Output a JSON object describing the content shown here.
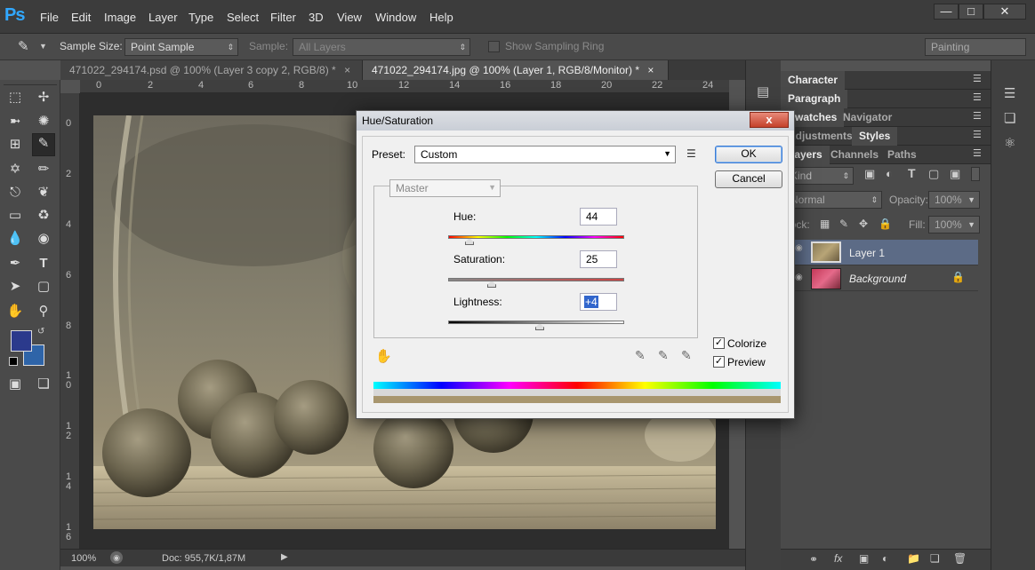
{
  "app": {
    "logo": "Ps"
  },
  "menu": [
    "File",
    "Edit",
    "Image",
    "Layer",
    "Type",
    "Select",
    "Filter",
    "3D",
    "View",
    "Window",
    "Help"
  ],
  "options": {
    "sample_size_label": "Sample Size:",
    "sample_size_value": "Point Sample",
    "sample_label": "Sample:",
    "sample_value": "All Layers",
    "sampling_ring_label": "Show Sampling Ring",
    "workspace": "Painting"
  },
  "tabs": [
    {
      "label": "471022_294174.psd @ 100% (Layer 3 copy 2, RGB/8) *",
      "close": "×"
    },
    {
      "label": "471022_294174.jpg @ 100% (Layer 1, RGB/8/Monitor) *",
      "close": "×"
    }
  ],
  "ruler": {
    "h": [
      "0",
      "2",
      "4",
      "6",
      "8",
      "10",
      "12",
      "14",
      "16",
      "18",
      "20",
      "22",
      "24"
    ],
    "v": [
      "0",
      "2",
      "4",
      "6",
      "8",
      "1 0",
      "1 2",
      "1 4",
      "1 6"
    ]
  },
  "status": {
    "zoom": "100%",
    "doc": "Doc: 955,7K/1,87M"
  },
  "panels": {
    "group1": [
      "Character"
    ],
    "group2": [
      "Paragraph"
    ],
    "group3": [
      "Swatches",
      "Navigator"
    ],
    "group4": [
      "Adjustments",
      "Styles"
    ],
    "group5": [
      "Layers",
      "Channels",
      "Paths"
    ],
    "kind": "Kind",
    "blend_mode": "Normal",
    "opacity_label": "Opacity:",
    "opacity_value": "100%",
    "lock_label": "Lock:",
    "fill_label": "Fill:",
    "fill_value": "100%",
    "layers": [
      {
        "name": "Layer 1",
        "selected": true
      },
      {
        "name": "Background",
        "selected": false
      }
    ]
  },
  "colors": {
    "foreground": "#2b3a8c",
    "background": "#2e64a8",
    "accent": "#31a8ff"
  },
  "dialog": {
    "title": "Hue/Saturation",
    "close": "x",
    "preset_label": "Preset:",
    "preset_value": "Custom",
    "channel": "Master",
    "hue_label": "Hue:",
    "hue_value": "44",
    "saturation_label": "Saturation:",
    "saturation_value": "25",
    "lightness_label": "Lightness:",
    "lightness_value": "+4",
    "ok": "OK",
    "cancel": "Cancel",
    "colorize_label": "Colorize",
    "colorize_checked": true,
    "preview_label": "Preview",
    "preview_checked": true
  },
  "icons": {
    "check": "✓"
  }
}
